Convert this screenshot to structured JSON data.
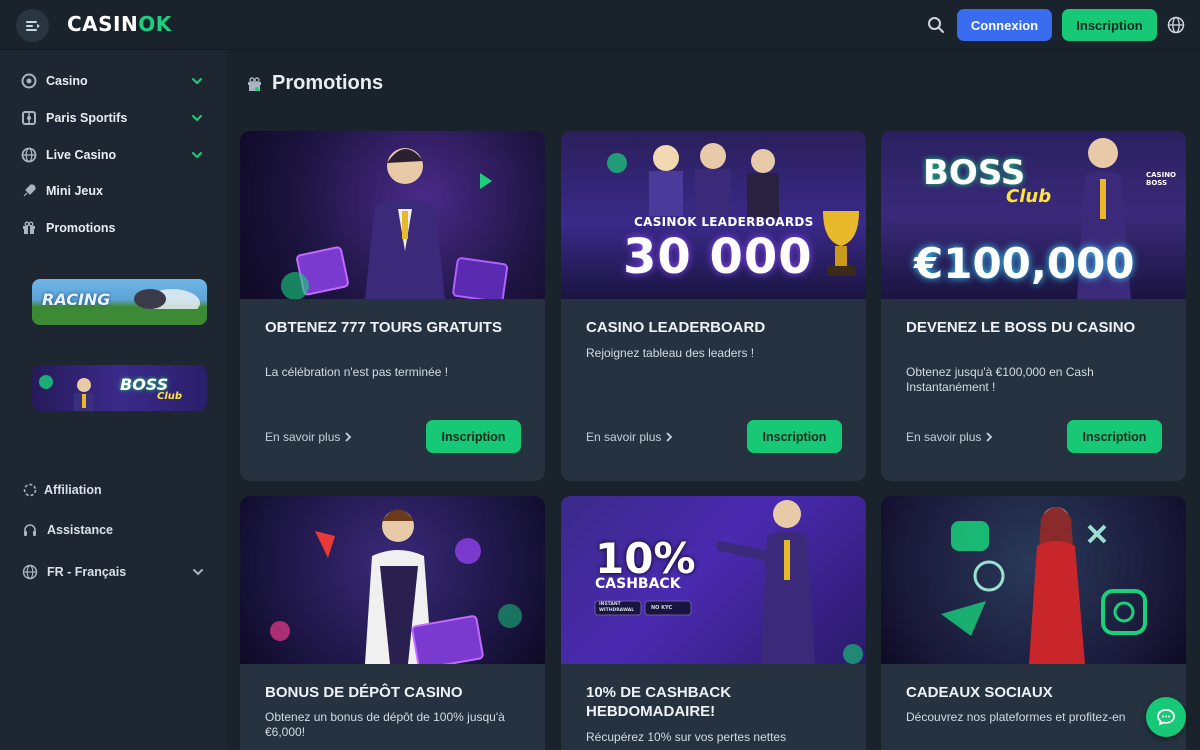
{
  "header": {
    "logo_main": "CASIN",
    "logo_accent": "OK",
    "login_label": "Connexion",
    "signup_label": "Inscription"
  },
  "sidebar": {
    "items": [
      {
        "label": "Casino",
        "icon": "casino-chip-icon",
        "has_chevron": true
      },
      {
        "label": "Paris Sportifs",
        "icon": "sports-icon",
        "has_chevron": true
      },
      {
        "label": "Live Casino",
        "icon": "live-globe-icon",
        "has_chevron": true
      },
      {
        "label": "Mini Jeux",
        "icon": "rocket-icon",
        "has_chevron": false
      },
      {
        "label": "Promotions",
        "icon": "gift-icon",
        "has_chevron": false
      }
    ],
    "banners": [
      {
        "text": "RACING"
      },
      {
        "text": "BOSS",
        "subtext": "Club"
      }
    ],
    "footer": [
      {
        "label": "Affiliation",
        "icon": "affiliation-icon"
      },
      {
        "label": "Assistance",
        "icon": "headset-icon"
      },
      {
        "label": "FR - Français",
        "icon": "globe-icon"
      }
    ]
  },
  "main": {
    "title": "Promotions",
    "cards": [
      {
        "title": "OBTENEZ 777 TOURS GRATUITS",
        "description": "La célébration n'est pas terminée !",
        "more_label": "En savoir plus",
        "cta_label": "Inscription"
      },
      {
        "title": "CASINO LEADERBOARD",
        "description": "Rejoignez tableau des leaders !",
        "more_label": "En savoir plus",
        "cta_label": "Inscription",
        "image_text_top": "CASINOK LEADERBOARDS",
        "image_text_big": "30 000"
      },
      {
        "title": "DEVENEZ LE BOSS DU CASINO",
        "description": "Obtenez jusqu'à €100,000 en Cash Instantanément !",
        "more_label": "En savoir plus",
        "cta_label": "Inscription",
        "image_text_logo": "BOSS",
        "image_text_logo_sub": "Club",
        "image_text_big": "€100,000",
        "image_text_small": "CASINO BOSS"
      },
      {
        "title": "BONUS DE DÉPÔT CASINO",
        "description": "Obtenez un bonus de dépôt de 100% jusqu'à €6,000!"
      },
      {
        "title": "10% DE CASHBACK HEBDOMADAIRE!",
        "description": "Récupérez 10% sur vos pertes nettes",
        "image_text_big": "10%",
        "image_text_sub": "CASHBACK",
        "image_badge_1": "INSTANT WITHDRAWAL",
        "image_badge_2": "NO KYC"
      },
      {
        "title": "CADEAUX SOCIAUX",
        "description": "Découvrez nos plateformes et profitez-en"
      }
    ]
  },
  "colors": {
    "accent_green": "#17c877",
    "login_blue": "#3a6cf0",
    "background": "#1a222c",
    "card": "#263240"
  }
}
